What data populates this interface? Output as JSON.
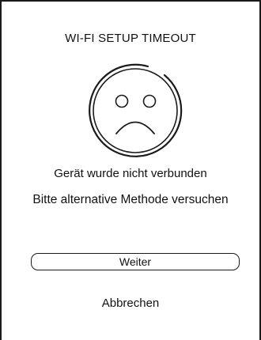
{
  "screen": {
    "title": "WI-FI SETUP TIMEOUT",
    "icon": "sad-face-icon",
    "message_line1": "Gerät wurde nicht verbunden",
    "message_line2": "Bitte alternative Methode versuchen"
  },
  "actions": {
    "continue_label": "Weiter",
    "cancel_label": "Abbrechen"
  },
  "colors": {
    "background": "#ffffff",
    "foreground": "#1a1a1a"
  }
}
